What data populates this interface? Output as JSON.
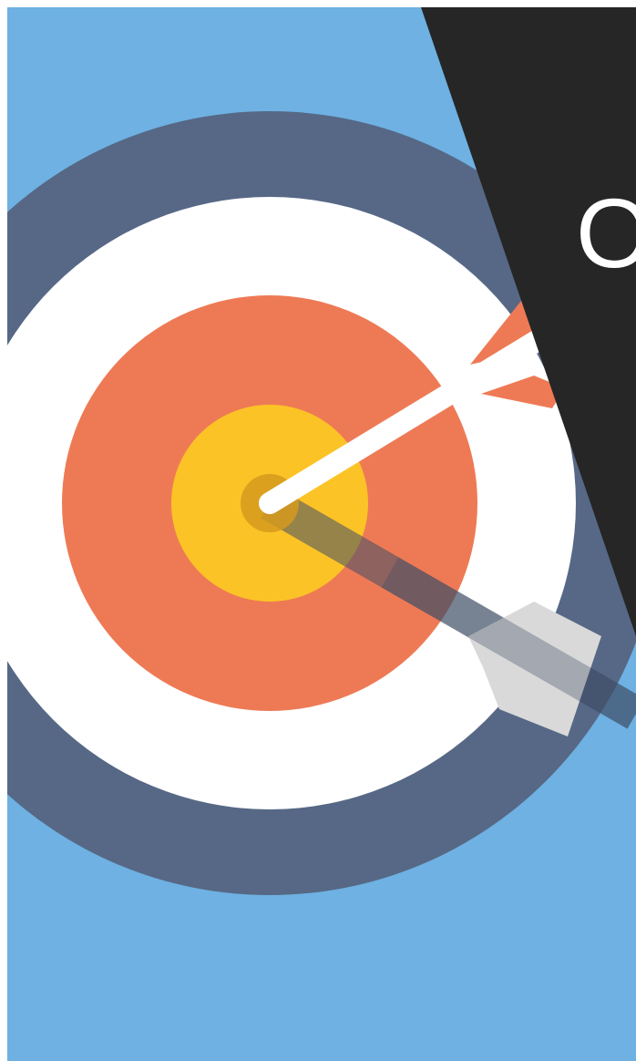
{
  "slide": {
    "headline": "O"
  },
  "illustration": {
    "icon": "target-with-arrow-icon",
    "colors": {
      "background": "#6EB1E2",
      "outer_ring": "#566885",
      "white_ring": "#FFFFFF",
      "red_ring": "#EE7A55",
      "bullseye": "#FCC326",
      "arrow_shaft": "#FFFFFF",
      "arrow_fletching": "#EE7A55",
      "shadow": "#3F4E66",
      "shadow_fletching": "#D9D9D9",
      "dark_panel": "#262626"
    }
  }
}
